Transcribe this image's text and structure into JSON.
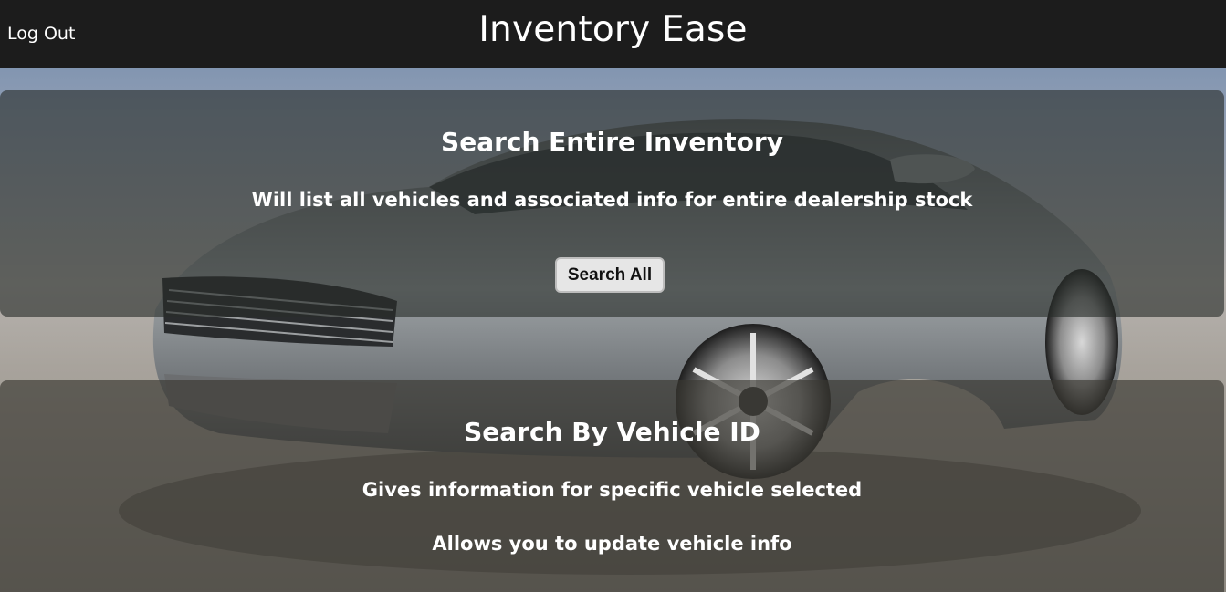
{
  "header": {
    "title": "Inventory Ease",
    "logout_label": "Log Out"
  },
  "search_all_panel": {
    "title": "Search Entire Inventory",
    "description": "Will list all vehicles and associated info for entire dealership stock",
    "button_label": "Search All"
  },
  "search_by_id_panel": {
    "title": "Search By Vehicle ID",
    "description_1": "Gives information for specific vehicle selected",
    "description_2": "Allows you to update vehicle info"
  },
  "colors": {
    "header_bg": "#1c1c1c",
    "text": "#ffffff",
    "button_bg": "#e6e6e6"
  }
}
